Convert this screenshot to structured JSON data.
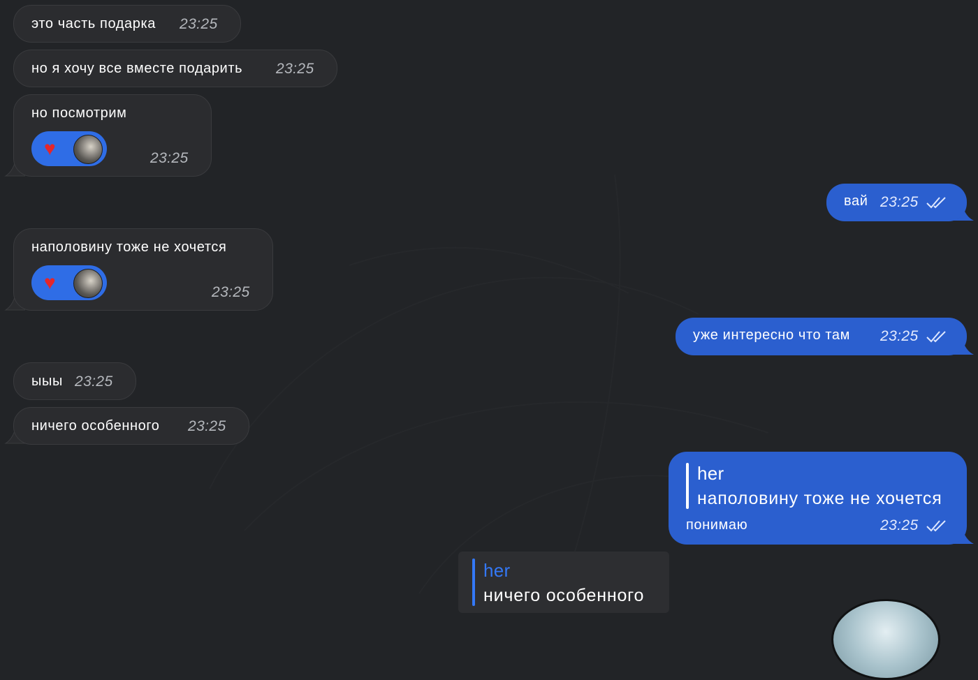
{
  "messages": {
    "m1": {
      "text": "это часть подарка",
      "time": "23:25"
    },
    "m2": {
      "text": "но я хочу все вместе подарить",
      "time": "23:25"
    },
    "m3": {
      "text": "но посмотрим",
      "time": "23:25",
      "reaction": "heart"
    },
    "m4": {
      "text": "вай",
      "time": "23:25",
      "status": "read"
    },
    "m5": {
      "text": "наполовину тоже не хочется",
      "time": "23:25",
      "reaction": "heart"
    },
    "m6": {
      "text": "уже интересно что там",
      "time": "23:25",
      "status": "read"
    },
    "m7": {
      "text": "ыыы",
      "time": "23:25"
    },
    "m8": {
      "text": "ничего особенного",
      "time": "23:25"
    },
    "m9": {
      "reply_name": "her",
      "reply_text": "наполовину тоже не хочется",
      "text": "понимаю",
      "time": "23:25",
      "status": "read"
    }
  },
  "composer_reply": {
    "name": "her",
    "text": "ничего особенного",
    "accent_color": "#3478f6"
  },
  "colors": {
    "background": "#222427",
    "incoming_bubble": "#2b2c2f",
    "outgoing_bubble": "#2b5fcf",
    "reaction_pill": "#2f6de6"
  }
}
